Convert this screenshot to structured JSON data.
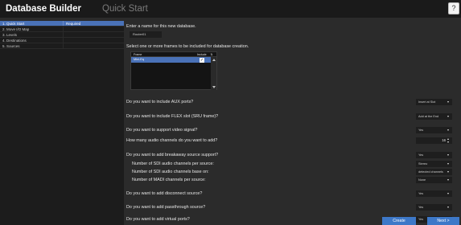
{
  "header": {
    "app_title": "Database Builder",
    "page_title": "Quick Start",
    "help_label": "?"
  },
  "sidebar": {
    "items": [
      {
        "label": "1. Quick Start",
        "status": "Required",
        "active": true
      },
      {
        "label": "2. Move I/O Map",
        "status": "",
        "active": false
      },
      {
        "label": "3. Levels",
        "status": "",
        "active": false
      },
      {
        "label": "4. Destinations",
        "status": "",
        "active": false
      },
      {
        "label": "5. Sources",
        "status": "",
        "active": false
      }
    ]
  },
  "main": {
    "name_prompt": "Enter a name for this new database.",
    "name_value": "Router01",
    "frames_prompt": "Select one or more frames to be included for database creation.",
    "frames_table": {
      "columns": [
        "Frame",
        "Include",
        "⇅"
      ],
      "rows": [
        {
          "frame": "Mini-Eq",
          "include": "✓"
        }
      ]
    },
    "questions": {
      "aux": {
        "label": "Do you want to include AUX ports?",
        "value": "Insert at Slot"
      },
      "flex": {
        "label": "Do you want to include FLEX slot (SRU frame)?",
        "value": "Add at the End"
      },
      "video": {
        "label": "Do you want to support video signal?",
        "value": "Yes"
      },
      "audio_channels": {
        "label": "How many audio channels do you want to add?",
        "value": "16"
      },
      "breakaway": {
        "label": "Do you want to add breakaway source support?",
        "value": "Yes"
      },
      "sdi_per_source": {
        "label": "Number of SDI audio channels per source:",
        "value": "Stereo"
      },
      "sdi_base": {
        "label": "Number of SDI audio channels base on:",
        "value": "detected channels"
      },
      "madi_per_source": {
        "label": "Number of MADI channels per source:",
        "value": "None"
      },
      "disconnect": {
        "label": "Do you want to add disconnect source?",
        "value": "Yes"
      },
      "passthrough": {
        "label": "Do you want to add passthrough source?",
        "value": "Yes"
      },
      "virtual": {
        "label": "Do you want to add virtual ports?",
        "value": "Yes"
      }
    }
  },
  "footer": {
    "create_label": "Create",
    "next_label": "Next >"
  },
  "colors": {
    "accent": "#4a72b8",
    "button": "#3d78c8",
    "background": "#2b2b2b",
    "sidebar": "#1c1c1c",
    "header": "#1a1a1a"
  }
}
